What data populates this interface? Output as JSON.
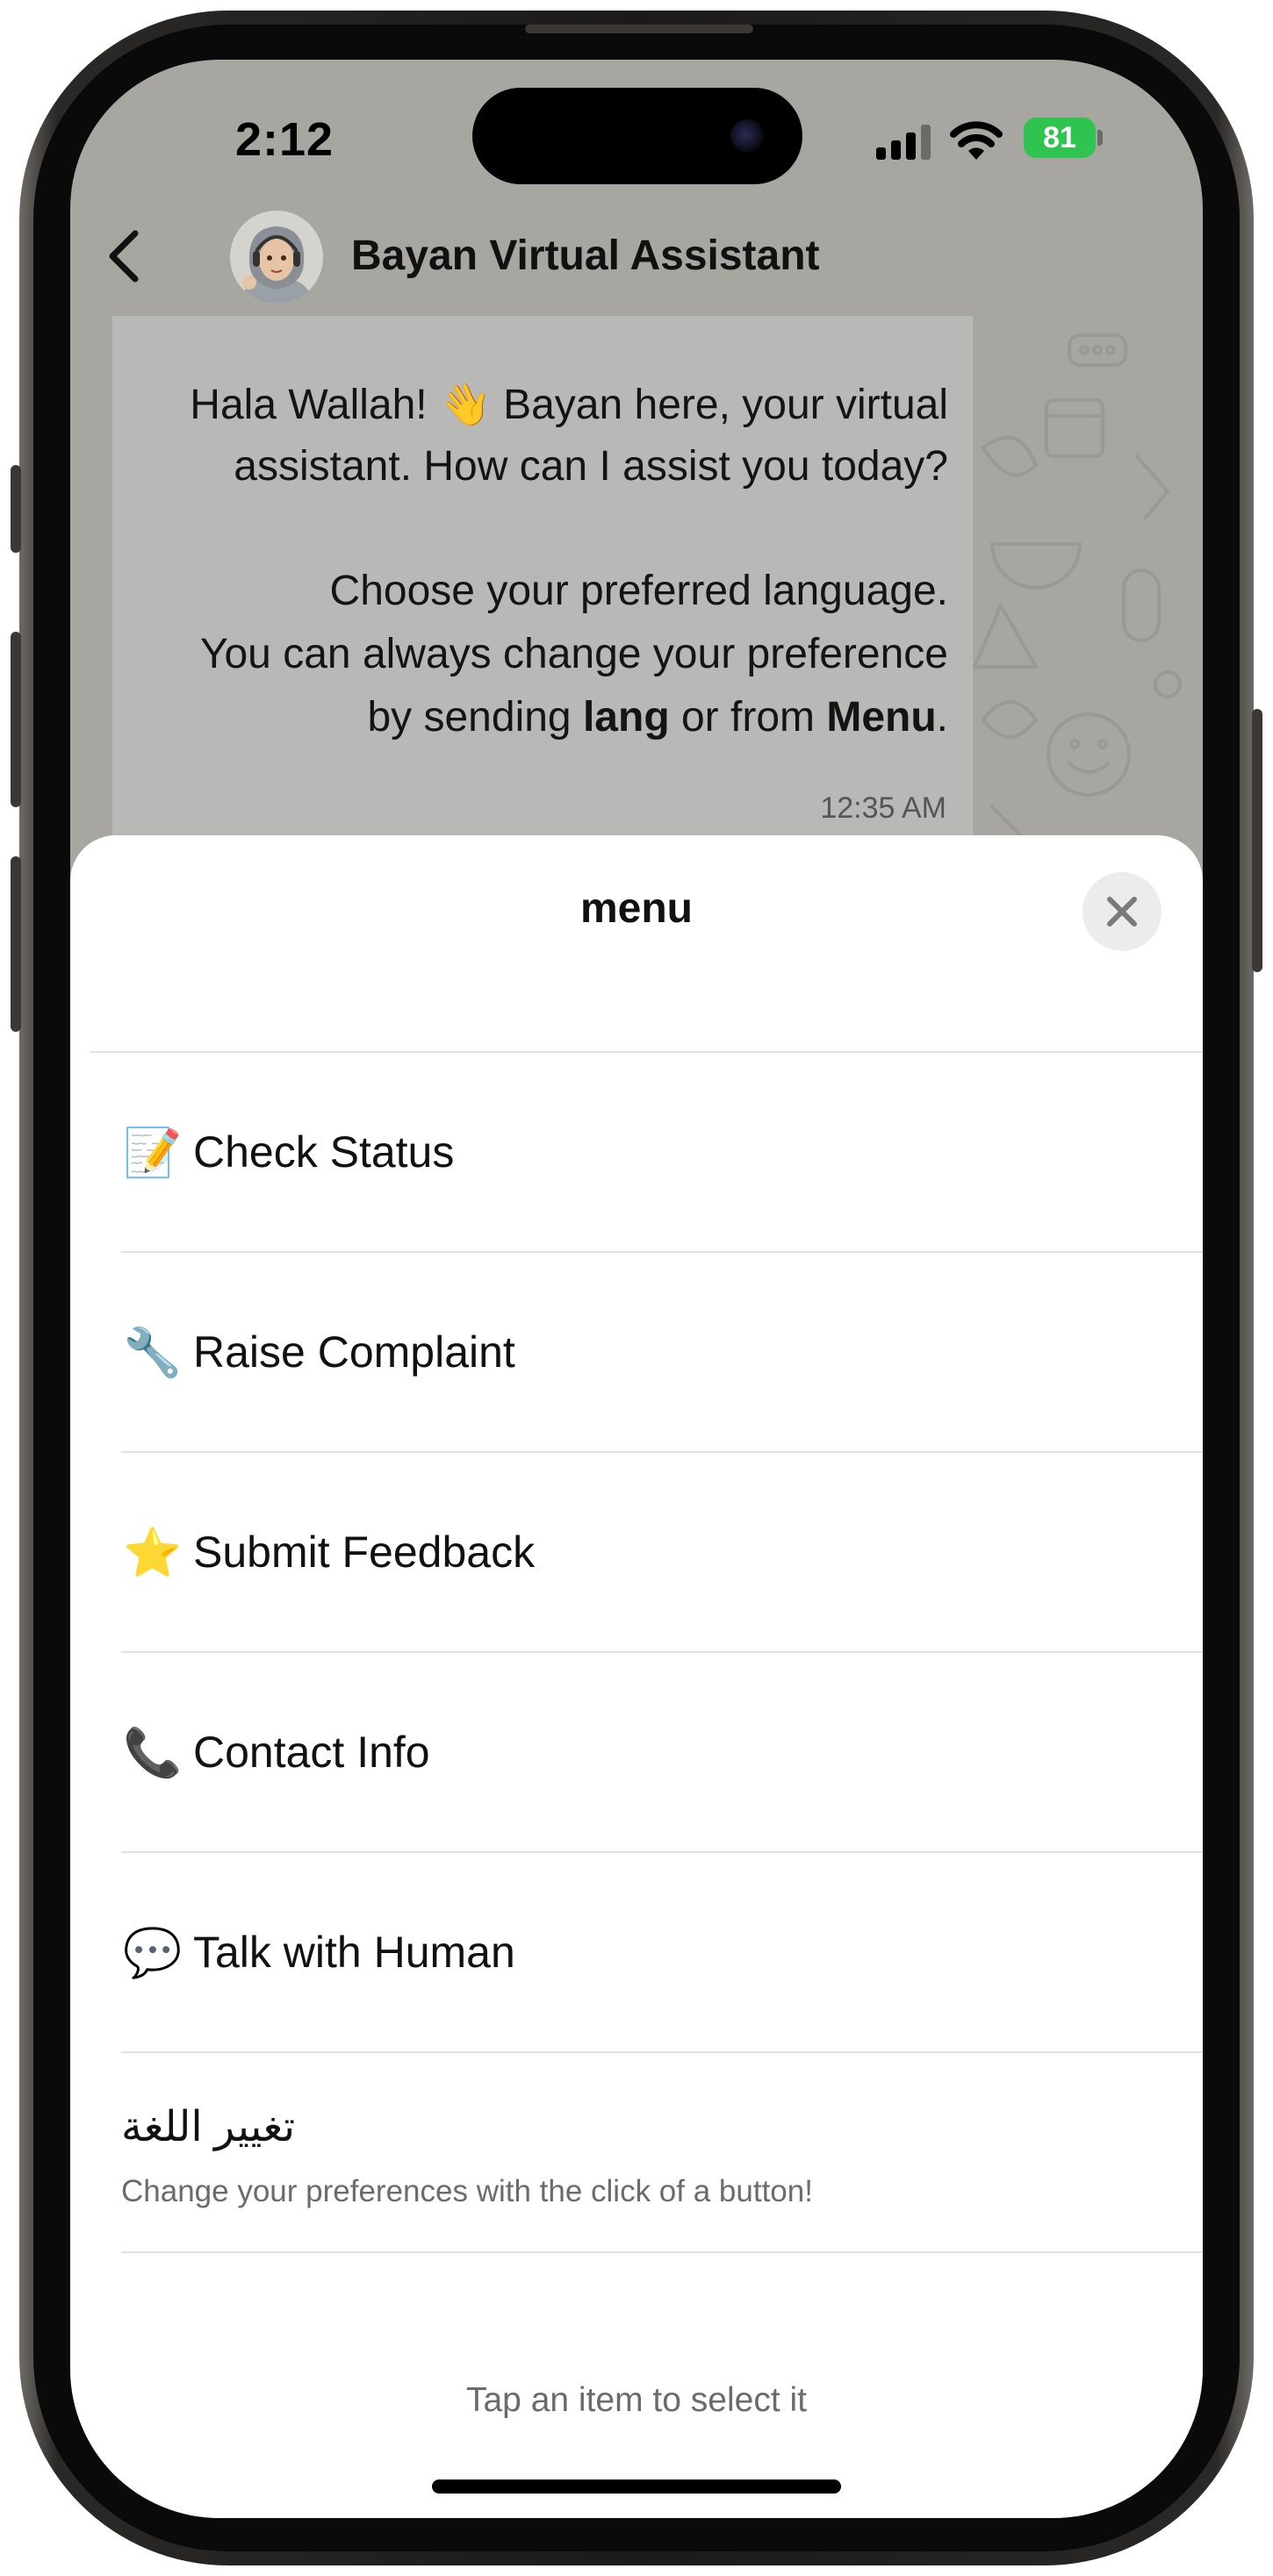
{
  "status_bar": {
    "time": "2:12",
    "battery": "81",
    "icons": [
      "signal-icon",
      "wifi-icon",
      "battery-icon"
    ]
  },
  "chat_header": {
    "title": "Bayan Virtual Assistant",
    "back_icon": "chevron-left-icon",
    "avatar": "assistant-avatar"
  },
  "message": {
    "line1": "Hala Wallah! 👋 Bayan here, your virtual",
    "line2": "assistant. How can I assist you today?",
    "line3": "Choose your preferred language.",
    "line4": "You can always change your preference",
    "line5_pre": "by sending ",
    "line5_bold1": "lang",
    "line5_mid": " or from ",
    "line5_bold2": "Menu",
    "line5_post": ".",
    "time": "12:35 AM"
  },
  "sheet": {
    "title": "menu",
    "close_icon": "close-icon",
    "items": [
      {
        "emoji": "📝",
        "icon": "memo-icon",
        "label": "Check Status"
      },
      {
        "emoji": "🔧",
        "icon": "wrench-icon",
        "label": "Raise Complaint"
      },
      {
        "emoji": "⭐",
        "icon": "star-icon",
        "label": "Submit Feedback"
      },
      {
        "emoji": "📞",
        "icon": "phone-icon",
        "label": "Contact Info"
      },
      {
        "emoji": "💬",
        "icon": "speech-bubble-icon",
        "label": "Talk with Human"
      },
      {
        "label": "تغيير اللغة",
        "description": "Change your preferences with the click of a button!"
      }
    ],
    "footer": "Tap an item to select it"
  },
  "colors": {
    "chat_background": "#a7a6a1",
    "bubble": "#b8b8b6",
    "sheet": "#ffffff",
    "battery": "#2fc34f"
  }
}
